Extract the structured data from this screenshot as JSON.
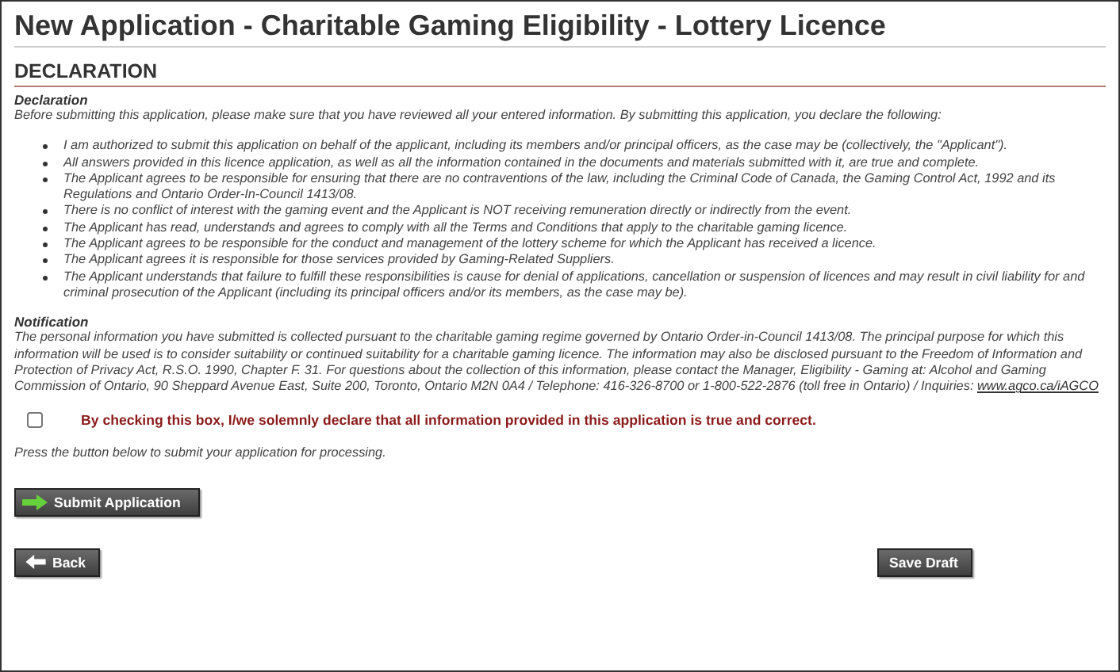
{
  "page_title": "New Application - Charitable Gaming Eligibility - Lottery Licence",
  "section": {
    "heading": "DECLARATION"
  },
  "declaration": {
    "label": "Declaration",
    "intro": "Before submitting this application, please make sure that you have reviewed all your entered information. By submitting this application, you declare the following:",
    "items": [
      "I am authorized to submit this application on behalf of the applicant, including its members and/or principal officers, as the case may be (collectively, the \"Applicant\").",
      "All answers provided in this licence application, as well as all the information contained in the documents and materials submitted with it, are true and complete.",
      "The Applicant agrees to be responsible for ensuring that there are no contraventions of the law, including the Criminal Code of Canada, the Gaming Control Act, 1992 and its Regulations and Ontario Order-In-Council 1413/08.",
      "There is no conflict of interest with the gaming event and the Applicant is NOT receiving remuneration directly or indirectly from the event.",
      "The Applicant has read, understands and agrees to comply with all the Terms and Conditions that apply to the charitable gaming licence.",
      "The Applicant agrees to be responsible for the conduct and management of the lottery scheme for which the Applicant has received a licence.",
      "The Applicant agrees it is responsible for those services provided by Gaming-Related Suppliers.",
      "The Applicant understands that failure to fulfill these responsibilities is cause for denial of applications, cancellation or suspension of licences and may result in civil liability for and criminal prosecution of the Applicant (including its principal officers and/or its members, as the case may be)."
    ]
  },
  "notification": {
    "label": "Notification",
    "text": "The personal information you have submitted is collected pursuant to the charitable gaming regime governed by Ontario Order-in-Council 1413/08. The principal purpose for which this information will be used is to consider suitability or continued suitability for a charitable gaming licence. The information may also be disclosed pursuant to the Freedom of Information and Protection of Privacy Act, R.S.O. 1990, Chapter F. 31. For questions about the collection of this information, please contact the Manager, Eligibility - Gaming at: Alcohol and Gaming Commission of Ontario, 90 Sheppard Avenue East, Suite 200, Toronto, Ontario M2N 0A4 / Telephone: 416-326-8700 or 1-800-522-2876 (toll free in Ontario) / Inquiries: ",
    "link": "www.agco.ca/iAGCO"
  },
  "confirm": {
    "label": "By checking this box, I/we solemnly declare that all information provided in this application is true and correct.",
    "checked": false
  },
  "instruction": "Press the button below to submit your application for processing.",
  "submit_button": "Submit Application",
  "back_button": "Back",
  "save_button": "Save Draft"
}
